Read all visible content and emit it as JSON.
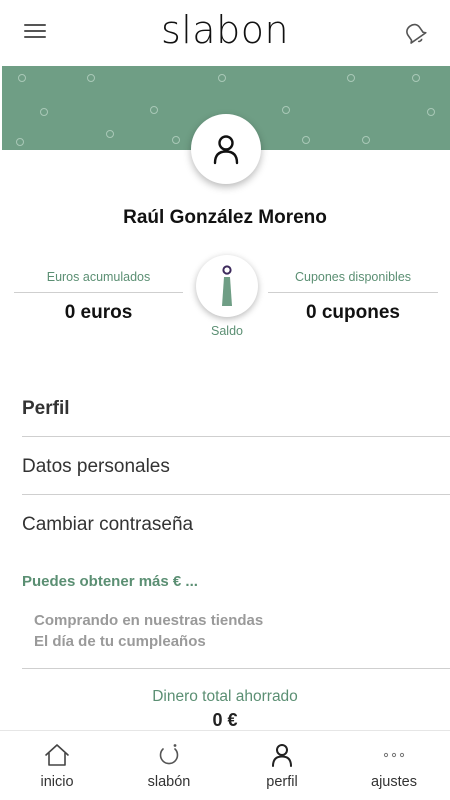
{
  "header": {
    "logo": "slabon",
    "menu_icon": "hamburger-menu-icon",
    "notification_icon": "bell-icon"
  },
  "colors": {
    "brand_green": "#6f9e85",
    "accent_green_text": "#5b8f73",
    "brand_purple": "#3d2a5c"
  },
  "profile": {
    "name": "Raúl González Moreno",
    "avatar_icon": "user-icon"
  },
  "stats": {
    "euros_label": "Euros acumulados",
    "euros_value": "0 euros",
    "coupons_label": "Cupones disponibles",
    "coupons_value": "0 cupones",
    "saldo_label": "Saldo"
  },
  "menu": {
    "section_title": "Perfil",
    "items": [
      "Datos personales",
      "Cambiar contraseña"
    ]
  },
  "promo": {
    "title": "Puedes obtener más € ...",
    "items": [
      "Comprando en nuestras tiendas",
      "El día de tu cumpleaños"
    ]
  },
  "savings": {
    "label": "Dinero total ahorrado",
    "value": "0 €"
  },
  "bottom_nav": [
    {
      "label": "inicio",
      "icon": "home-icon"
    },
    {
      "label": "slabón",
      "icon": "slabon-ring-icon"
    },
    {
      "label": "perfil",
      "icon": "user-icon",
      "active": true
    },
    {
      "label": "ajustes",
      "icon": "more-dots-icon"
    }
  ]
}
